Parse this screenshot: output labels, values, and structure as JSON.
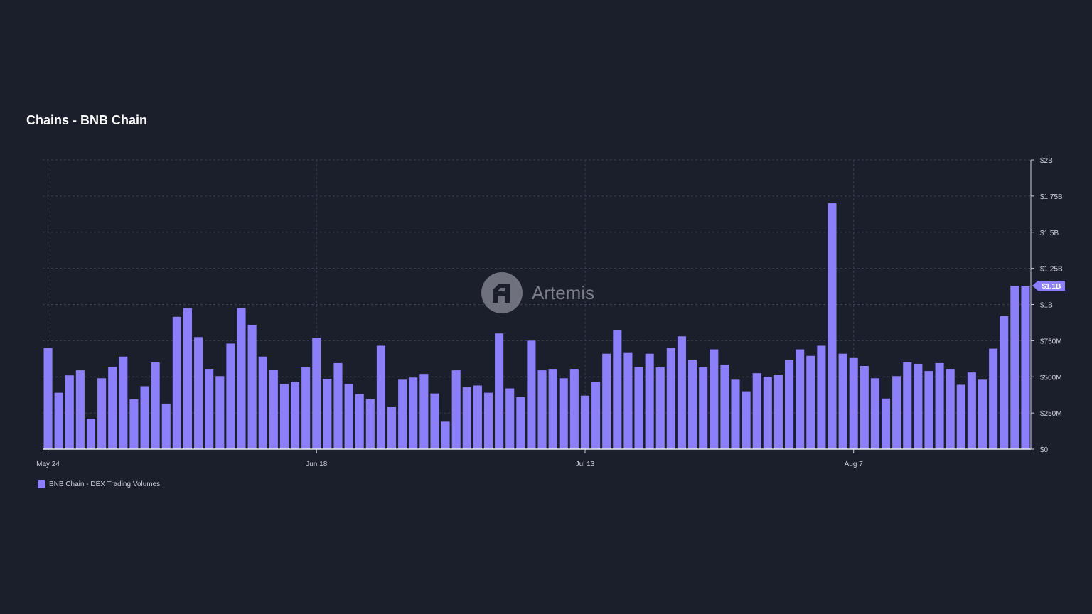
{
  "chart_data": {
    "type": "bar",
    "title": "Chains - BNB Chain",
    "x_tick_labels": [
      "May 24",
      "Jun 18",
      "Jul 13",
      "Aug 7"
    ],
    "y_tick_labels": [
      "$0",
      "$250M",
      "$500M",
      "$750M",
      "$1B",
      "$1.25B",
      "$1.5B",
      "$1.75B",
      "$2B"
    ],
    "ylim": [
      0,
      2000
    ],
    "y_unit": "M USD",
    "grid": true,
    "legend_position": "bottom-left",
    "last_value_label": "$1.1B",
    "series": [
      {
        "name": "BNB Chain - DEX Trading Volumes",
        "color": "#8b80f9",
        "values": [
          700,
          390,
          510,
          545,
          210,
          490,
          570,
          640,
          345,
          435,
          600,
          315,
          915,
          975,
          775,
          555,
          505,
          730,
          975,
          860,
          640,
          550,
          450,
          465,
          565,
          770,
          485,
          595,
          450,
          380,
          345,
          715,
          290,
          480,
          495,
          520,
          385,
          190,
          545,
          430,
          440,
          390,
          800,
          420,
          360,
          750,
          545,
          555,
          490,
          555,
          370,
          465,
          660,
          825,
          665,
          570,
          660,
          565,
          700,
          780,
          615,
          565,
          690,
          585,
          480,
          400,
          525,
          500,
          515,
          615,
          690,
          645,
          715,
          1700,
          660,
          630,
          575,
          490,
          350,
          505,
          600,
          590,
          540,
          595,
          555,
          445,
          530,
          480,
          695,
          920,
          1130,
          1130
        ]
      }
    ]
  },
  "watermark": {
    "text": "Artemis",
    "icon": "artemis-logo-icon"
  }
}
